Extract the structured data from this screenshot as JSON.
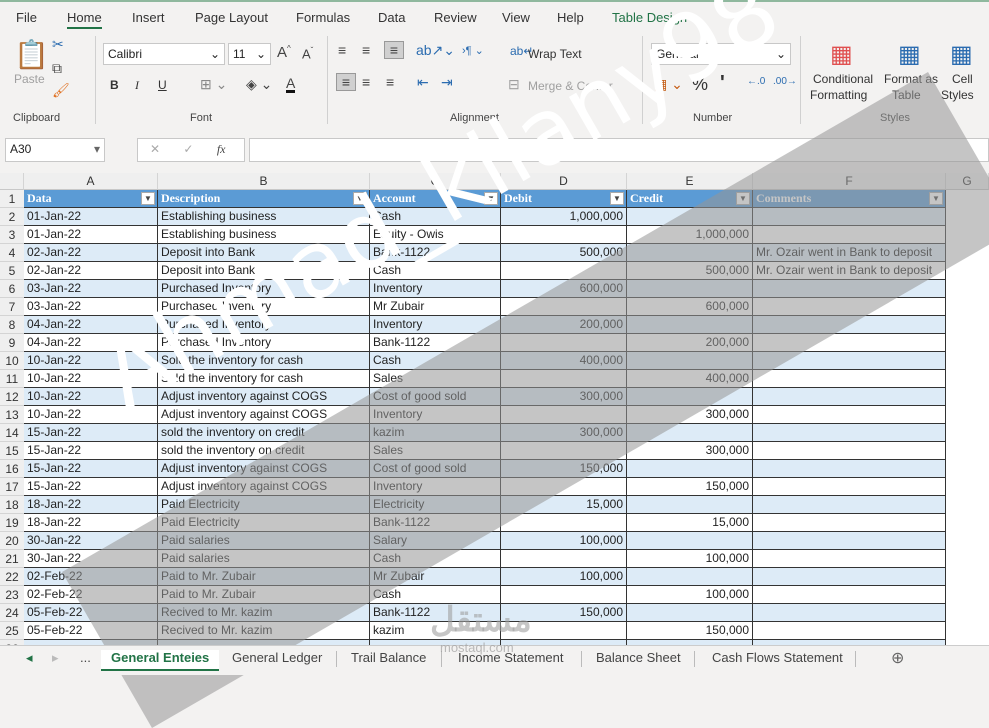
{
  "menu": [
    "File",
    "Home",
    "Insert",
    "Page Layout",
    "Formulas",
    "Data",
    "Review",
    "View",
    "Help",
    "Table Design"
  ],
  "ribbon": {
    "clipboard": {
      "paste": "Paste",
      "label": "Clipboard"
    },
    "font": {
      "name": "Calibri",
      "size": "11",
      "label": "Font",
      "bold": "B",
      "italic": "I",
      "underline": "U"
    },
    "alignment": {
      "wrap": "Wrap Text",
      "merge": "Merge & Center",
      "label": "Alignment"
    },
    "number": {
      "format": "General",
      "percent": "%",
      "comma": "'",
      "label": "Number"
    },
    "styles": {
      "conditional": "Conditional",
      "conditional2": "Formatting",
      "format_table": "Format as",
      "format_table2": "Table",
      "cell_styles": "Cell",
      "cell_styles2": "Styles",
      "label": "Styles"
    }
  },
  "formula_bar": {
    "name_box": "A30",
    "fx": "fx",
    "value": ""
  },
  "columns": [
    "A",
    "B",
    "C",
    "D",
    "E",
    "F",
    "G"
  ],
  "table_headers": [
    "Data",
    "Description",
    "Account",
    "Debit",
    "Credit",
    "Comments"
  ],
  "rows": [
    [
      "01-Jan-22",
      "Establishing business",
      "Cash",
      "1,000,000",
      "",
      ""
    ],
    [
      "01-Jan-22",
      "Establishing business",
      "Equity - Owis",
      "",
      "1,000,000",
      ""
    ],
    [
      "02-Jan-22",
      "Deposit into Bank",
      "Bank-1122",
      "500,000",
      "",
      "Mr. Ozair went in Bank to deposit"
    ],
    [
      "02-Jan-22",
      "Deposit into Bank",
      "Cash",
      "",
      "500,000",
      "Mr. Ozair went in Bank to deposit"
    ],
    [
      "03-Jan-22",
      "Purchased Inventory",
      "Inventory",
      "600,000",
      "",
      ""
    ],
    [
      "03-Jan-22",
      "Purchased Inventory",
      "Mr Zubair",
      "",
      "600,000",
      ""
    ],
    [
      "04-Jan-22",
      "Purchased Inventory",
      "Inventory",
      "200,000",
      "",
      ""
    ],
    [
      "04-Jan-22",
      "Purchased Inventory",
      "Bank-1122",
      "",
      "200,000",
      ""
    ],
    [
      "10-Jan-22",
      "Sold the inventory for cash",
      "Cash",
      "400,000",
      "",
      ""
    ],
    [
      "10-Jan-22",
      "Sold the inventory for cash",
      "Sales",
      "",
      "400,000",
      ""
    ],
    [
      "10-Jan-22",
      "Adjust inventory against COGS",
      "Cost of good sold",
      "300,000",
      "",
      ""
    ],
    [
      "10-Jan-22",
      "Adjust inventory against COGS",
      "Inventory",
      "",
      "300,000",
      ""
    ],
    [
      "15-Jan-22",
      "sold the inventory on credit",
      "kazim",
      "300,000",
      "",
      ""
    ],
    [
      "15-Jan-22",
      "sold the inventory on credit",
      "Sales",
      "",
      "300,000",
      ""
    ],
    [
      "15-Jan-22",
      "Adjust inventory against COGS",
      "Cost of good sold",
      "150,000",
      "",
      ""
    ],
    [
      "15-Jan-22",
      "Adjust inventory against COGS",
      "Inventory",
      "",
      "150,000",
      ""
    ],
    [
      "18-Jan-22",
      "Paid Electricity",
      "Electricity",
      "15,000",
      "",
      ""
    ],
    [
      "18-Jan-22",
      "Paid Electricity",
      "Bank-1122",
      "",
      "15,000",
      ""
    ],
    [
      "30-Jan-22",
      "Paid salaries",
      "Salary",
      "100,000",
      "",
      ""
    ],
    [
      "30-Jan-22",
      "Paid salaries",
      "Cash",
      "",
      "100,000",
      ""
    ],
    [
      "02-Feb-22",
      "Paid to Mr. Zubair",
      "Mr Zubair",
      "100,000",
      "",
      ""
    ],
    [
      "02-Feb-22",
      "Paid to Mr. Zubair",
      "Cash",
      "",
      "100,000",
      ""
    ],
    [
      "05-Feb-22",
      "Recived to Mr. kazim",
      "Bank-1122",
      "150,000",
      "",
      ""
    ],
    [
      "05-Feb-22",
      "Recived to Mr. kazim",
      "kazim",
      "",
      "150,000",
      ""
    ]
  ],
  "sheet_tabs": [
    "General Enteies",
    "General Ledger",
    "Trail Balance",
    "Income Statement",
    "Balance Sheet",
    "Cash Flows Statement"
  ],
  "sheet_nav_more": "...",
  "watermark": "Ahmad_kilany98",
  "logo": {
    "arabic": "مستقل",
    "latin": "mostaql.com"
  },
  "colors": {
    "header": "#5b9bd5",
    "band": "#ddebf7",
    "accent": "#217346"
  }
}
